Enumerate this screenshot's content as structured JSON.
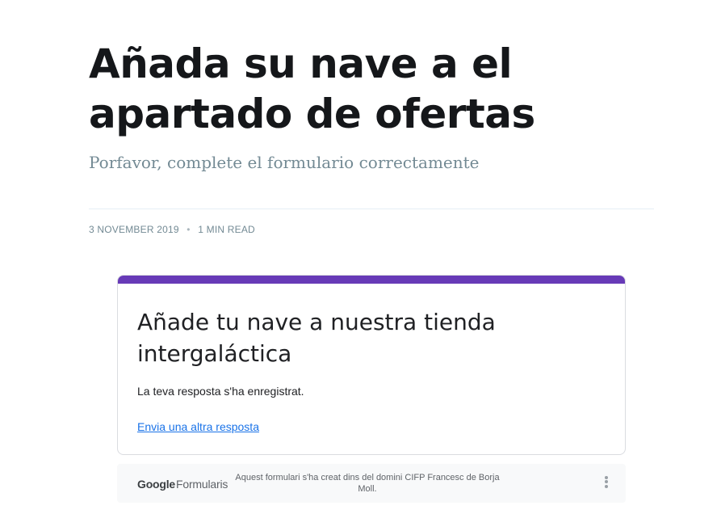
{
  "article": {
    "title": "Añada su nave a el apartado de ofertas",
    "excerpt": "Porfavor, complete el formulario correctamente",
    "date": "3 November 2019",
    "bullet": "•",
    "reading_time": "1 min read"
  },
  "form": {
    "accent_color": "#673ab7",
    "title": "Añade tu nave a nuestra tienda intergaláctica",
    "response_message": "La teva resposta s'ha enregistrat.",
    "another_response_link": "Envia una altra resposta"
  },
  "footer": {
    "brand_google": "Google",
    "brand_product": "Formularis",
    "notice": "Aquest formulari s'ha creat dins del domini CIFP Francesc de Borja Moll.",
    "more_icon": "more-vertical-icon"
  }
}
